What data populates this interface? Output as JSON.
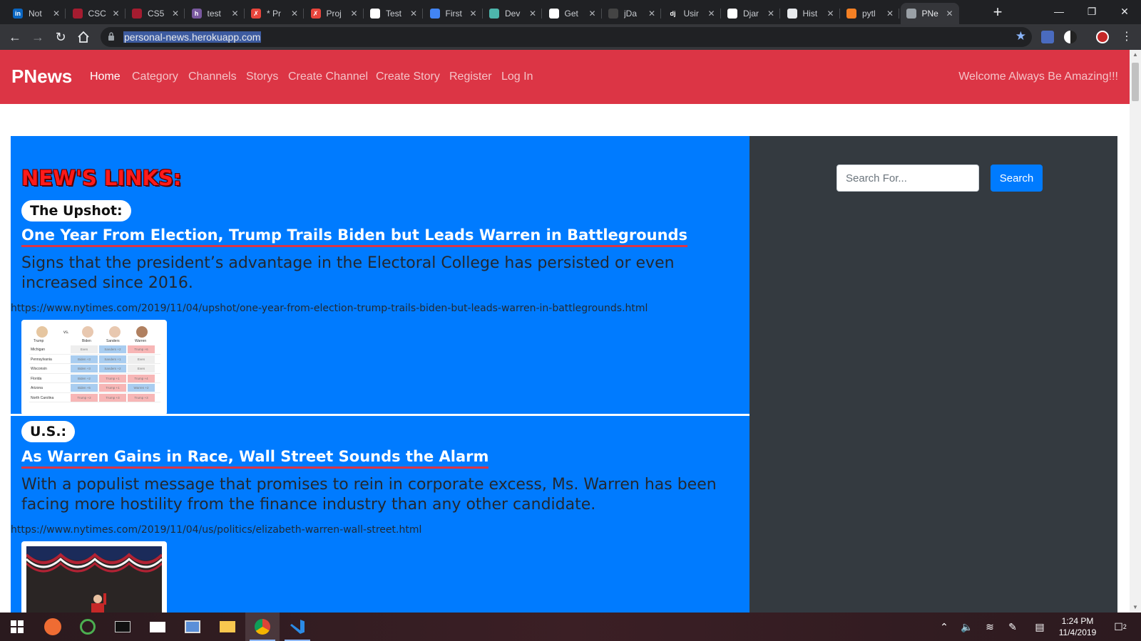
{
  "browser": {
    "tabs": [
      {
        "title": "Not",
        "icon": "linkedin-icon",
        "color": "#0a66c2",
        "glyph": "in"
      },
      {
        "title": "CSC",
        "icon": "harvard-shield-icon",
        "color": "#a51c30",
        "glyph": ""
      },
      {
        "title": "CS5",
        "icon": "harvard-shield-icon",
        "color": "#a51c30",
        "glyph": ""
      },
      {
        "title": "test",
        "icon": "heroku-icon",
        "color": "#79589f",
        "glyph": "h"
      },
      {
        "title": "* Pr",
        "icon": "markdown-editor-icon",
        "color": "#e8453c",
        "glyph": "✗"
      },
      {
        "title": "Proj",
        "icon": "markdown-editor-icon",
        "color": "#e8453c",
        "glyph": "✗"
      },
      {
        "title": "Test",
        "icon": "postman-icon",
        "color": "#ffffff",
        "glyph": ""
      },
      {
        "title": "First",
        "icon": "docs-icon",
        "color": "#4285f4",
        "glyph": ""
      },
      {
        "title": "Dev",
        "icon": "devcenter-icon",
        "color": "#4db6ac",
        "glyph": ""
      },
      {
        "title": "Get",
        "icon": "postman-icon",
        "color": "#ffffff",
        "glyph": ""
      },
      {
        "title": "jDa",
        "icon": "github-icon",
        "color": "#444444",
        "glyph": ""
      },
      {
        "title": "Usir",
        "icon": "django-icon",
        "color": "#202124",
        "glyph": "dj"
      },
      {
        "title": "Djar",
        "icon": "openai-icon",
        "color": "#ffffff",
        "glyph": ""
      },
      {
        "title": "Hist",
        "icon": "history-icon",
        "color": "#e8eaed",
        "glyph": ""
      },
      {
        "title": "pytl",
        "icon": "stackoverflow-icon",
        "color": "#f48024",
        "glyph": ""
      },
      {
        "title": "PNe",
        "icon": "globe-icon",
        "color": "#9aa0a6",
        "glyph": "",
        "active": true
      }
    ],
    "new_tab": "+",
    "window_controls": {
      "minimize": "—",
      "restore": "❐",
      "close": "✕"
    },
    "url": "personal-news.herokuapp.com",
    "star_icon": "★"
  },
  "site": {
    "brand": "PNews",
    "nav": [
      {
        "label": "Home",
        "active": true
      },
      {
        "label": "Category"
      },
      {
        "label": "Channels"
      },
      {
        "label": "Storys"
      },
      {
        "label": "Create Channel"
      },
      {
        "label": "Create Story"
      },
      {
        "label": "Register"
      },
      {
        "label": "Log In"
      }
    ],
    "welcome": "Welcome Always Be Amazing!!!",
    "colors": {
      "navbar": "#dc3545",
      "main": "#007bff",
      "sidebar": "#343a40"
    }
  },
  "main": {
    "heading": "NEW'S LINKS:",
    "articles": [
      {
        "category": "The Upshot:",
        "title": "One Year From Election, Trump Trails Biden but Leads Warren in Battlegrounds",
        "description": "Signs that the president’s advantage in the Electoral College has persisted or even increased since 2016.",
        "url": "https://www.nytimes.com/2019/11/04/upshot/one-year-from-election-trump-trails-biden-but-leads-warren-in-battlegrounds.html",
        "thumbnail": {
          "candidates": [
            "Trump",
            "Biden",
            "Sanders",
            "Warren"
          ],
          "vs": "vs.",
          "rows": [
            {
              "state": "Michigan",
              "cells": [
                "Even",
                "Sanders +2",
                "Trump +6"
              ]
            },
            {
              "state": "Pennsylvania",
              "cells": [
                "Biden +3",
                "Sanders +1",
                "Even"
              ]
            },
            {
              "state": "Wisconsin",
              "cells": [
                "Biden +3",
                "Sanders +2",
                "Even"
              ]
            },
            {
              "state": "Florida",
              "cells": [
                "Biden +2",
                "Trump +1",
                "Trump +4"
              ]
            },
            {
              "state": "Arizona",
              "cells": [
                "Biden +5",
                "Trump +1",
                "Warren +2"
              ]
            },
            {
              "state": "North Carolina",
              "cells": [
                "Trump +2",
                "Trump +3",
                "Trump +3"
              ]
            }
          ]
        }
      },
      {
        "category": "U.S.:",
        "title": "As Warren Gains in Race, Wall Street Sounds the Alarm",
        "description": "With a populist message that promises to rein in corporate excess, Ms. Warren has been facing more hostility from the finance industry than any other candidate.",
        "url": "https://www.nytimes.com/2019/11/04/us/politics/elizabeth-warren-wall-street.html"
      }
    ]
  },
  "sidebar": {
    "search_placeholder": "Search For...",
    "search_button": "Search"
  },
  "taskbar": {
    "time": "1:24 PM",
    "date": "11/4/2019",
    "notification_count": "2"
  }
}
